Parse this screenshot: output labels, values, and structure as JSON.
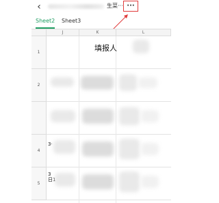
{
  "header": {
    "back_icon": "chevron-left-icon",
    "title_suffix": "生菜···",
    "more_label": "···"
  },
  "tabs": [
    {
      "label": "Sheet2",
      "active": true
    },
    {
      "label": "Sheet3",
      "active": false
    }
  ],
  "grid": {
    "columns": [
      "J",
      "K",
      "L"
    ],
    "rows": [
      "1",
      "2",
      "",
      "4",
      "5"
    ],
    "cells": {
      "r1_title": "填报人",
      "r4_fragment": "3·",
      "r5_fragment": "3",
      "r5_fragment_b": "日1"
    }
  },
  "colors": {
    "accent": "#1f9d62",
    "highlight": "#e03a3a"
  }
}
